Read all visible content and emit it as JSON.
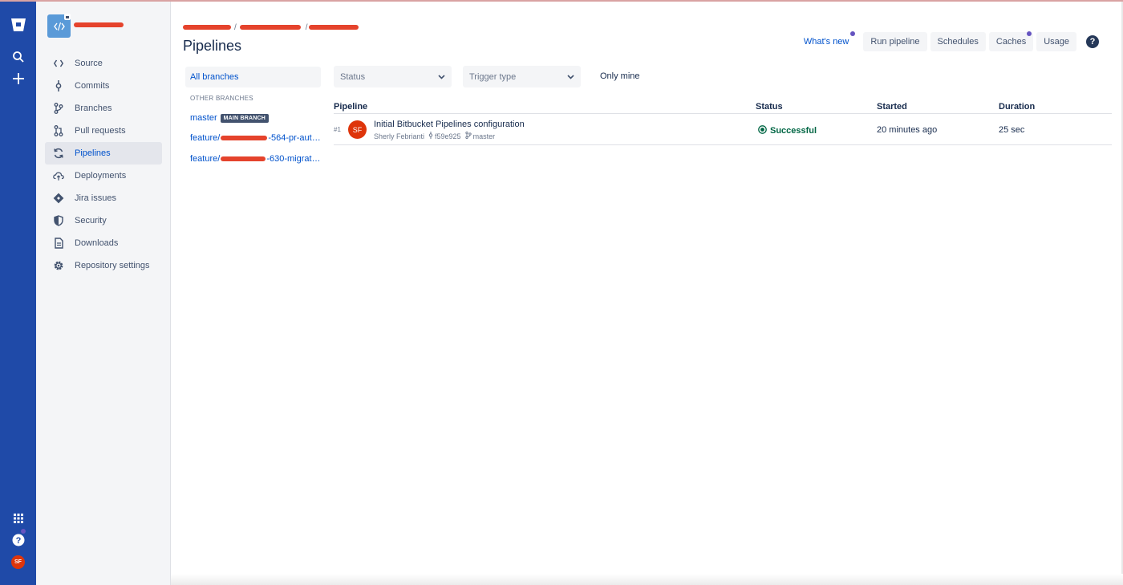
{
  "sidebar": {
    "items": [
      {
        "label": "Source",
        "icon": "code-icon"
      },
      {
        "label": "Commits",
        "icon": "commit-icon"
      },
      {
        "label": "Branches",
        "icon": "branch-icon"
      },
      {
        "label": "Pull requests",
        "icon": "pull-request-icon"
      },
      {
        "label": "Pipelines",
        "icon": "pipelines-icon",
        "active": true
      },
      {
        "label": "Deployments",
        "icon": "cloud-upload-icon"
      },
      {
        "label": "Jira issues",
        "icon": "jira-icon"
      },
      {
        "label": "Security",
        "icon": "shield-icon"
      },
      {
        "label": "Downloads",
        "icon": "file-icon"
      },
      {
        "label": "Repository settings",
        "icon": "gear-icon"
      }
    ]
  },
  "global_nav": {
    "user_initials": "SF"
  },
  "header": {
    "breadcrumb_separator": "/",
    "title": "Pipelines",
    "whats_new": "What's new",
    "run_pipeline": "Run pipeline",
    "schedules": "Schedules",
    "caches": "Caches",
    "usage": "Usage",
    "help": "?"
  },
  "branches": {
    "all_branches": "All branches",
    "other_heading": "OTHER BRANCHES",
    "master": "master",
    "main_badge": "MAIN BRANCH",
    "feature_prefix": "feature/",
    "feature1_suffix": "-564-pr-aut…",
    "feature2_suffix": "-630-migrat…"
  },
  "filters": {
    "status_placeholder": "Status",
    "trigger_placeholder": "Trigger type",
    "only_mine": "Only mine"
  },
  "table": {
    "headers": {
      "pipeline": "Pipeline",
      "status": "Status",
      "started": "Started",
      "duration": "Duration"
    },
    "rows": [
      {
        "number": "#1",
        "avatar_initials": "SF",
        "title": "Initial Bitbucket Pipelines configuration",
        "author": "Sherly Febrianti",
        "commit": "f59e925",
        "branch": "master",
        "status": "Successful",
        "started": "20 minutes ago",
        "duration": "25 sec"
      }
    ]
  },
  "colors": {
    "global_nav_bg": "#1f4aa8",
    "link": "#0052cc",
    "success": "#006644",
    "avatar": "#de350b",
    "redaction": "#e5432c",
    "notification_dot": "#6554c0"
  }
}
